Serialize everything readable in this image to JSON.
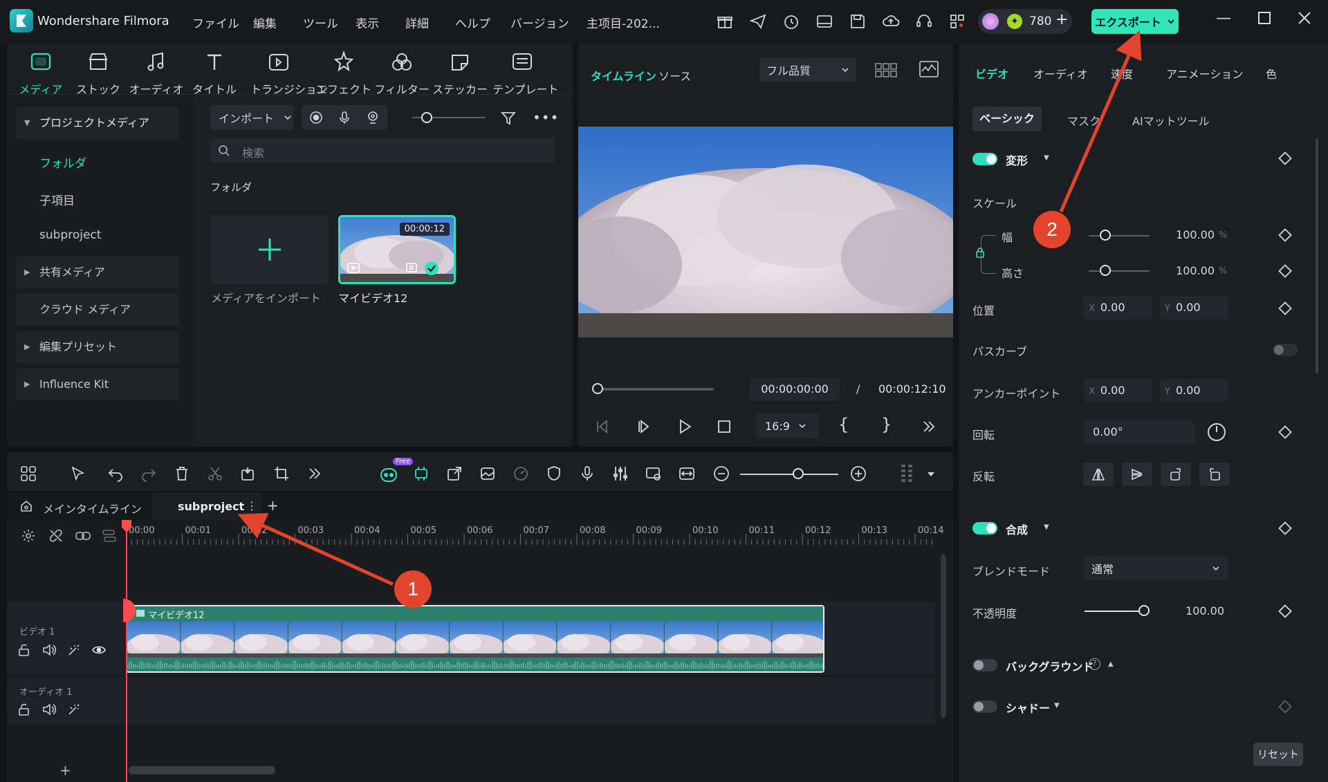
{
  "app": {
    "name": "Wondershare Filmora",
    "project_title": "主项目-202..."
  },
  "menu": [
    "ファイル",
    "編集",
    "ツール",
    "表示",
    "詳細",
    "ヘルプ",
    "バージョン"
  ],
  "credits": {
    "count": "780",
    "plus": "+"
  },
  "export_label": "エクスポート",
  "categories": [
    {
      "label": "メディア",
      "icon": "media-icon"
    },
    {
      "label": "ストック",
      "icon": "stock-icon"
    },
    {
      "label": "オーディオ",
      "icon": "music-icon"
    },
    {
      "label": "タイトル",
      "icon": "title-icon"
    },
    {
      "label": "トランジション",
      "icon": "transition-icon"
    },
    {
      "label": "エフェクト",
      "icon": "effect-icon"
    },
    {
      "label": "フィルター",
      "icon": "filter-icon"
    },
    {
      "label": "ステッカー",
      "icon": "sticker-icon"
    },
    {
      "label": "テンプレート",
      "icon": "template-icon"
    }
  ],
  "sidebar": {
    "project_media": "プロジェクトメディア",
    "folder": "フォルダ",
    "child_item": "子項目",
    "subproject": "subproject",
    "shared_media": "共有メディア",
    "cloud_media": "クラウド メディア",
    "edit_presets": "編集プリセット",
    "influence_kit": "Influence Kit"
  },
  "media": {
    "import_label": "インポート",
    "search_placeholder": "検索",
    "folder_heading": "フォルダ",
    "import_card_label": "メディアをインポート",
    "clip_label": "マイビデオ12",
    "clip_duration": "00:00:12"
  },
  "preview": {
    "tab_timeline": "タイムライン",
    "tab_source": "ソース",
    "quality": "フル品質",
    "current_time": "00:00:00:00",
    "separator": "/",
    "total_time": "00:00:12:10",
    "aspect_ratio": "16:9",
    "progress": 0
  },
  "props": {
    "tabs": [
      "ビデオ",
      "オーディオ",
      "速度",
      "アニメーション",
      "色"
    ],
    "subtabs": [
      "ベーシック",
      "マスク",
      "AIマットツール"
    ],
    "transform": "変形",
    "scale": "スケール",
    "width_label": "幅",
    "height_label": "高さ",
    "width_value": "100.00",
    "height_value": "100.00",
    "percent": "%",
    "position": "位置",
    "pos_x": "0.00",
    "pos_y": "0.00",
    "path_curve": "パスカーブ",
    "anchor": "アンカーポイント",
    "anchor_x": "0.00",
    "anchor_y": "0.00",
    "rotation": "回転",
    "rotation_value": "0.00°",
    "flip": "反転",
    "composite": "合成",
    "blend_mode": "ブレンドモード",
    "blend_value": "通常",
    "opacity": "不透明度",
    "opacity_value": "100.00",
    "background": "バックグラウンド",
    "shadow": "シャドー",
    "reset": "リセット",
    "axis_x": "X",
    "axis_y": "Y"
  },
  "timeline": {
    "tab_main": "メインタイムライン",
    "tab_sub": "subproject",
    "free_badge": "Free",
    "ticks": [
      "00:00",
      "00:01",
      "00:02",
      "00:03",
      "00:04",
      "00:05",
      "00:06",
      "00:07",
      "00:08",
      "00:09",
      "00:10",
      "00:11",
      "00:12",
      "00:13",
      "00:14"
    ],
    "video_track": "ビデオ 1",
    "audio_track": "オーディオ 1",
    "clip_name": "マイビデオ12",
    "add_track": "+"
  },
  "annotations": {
    "badge1": "1",
    "badge2": "2"
  },
  "colors": {
    "accent": "#2ee0c0",
    "annotation": "#e2452c",
    "clip": "#2d7f6e"
  }
}
